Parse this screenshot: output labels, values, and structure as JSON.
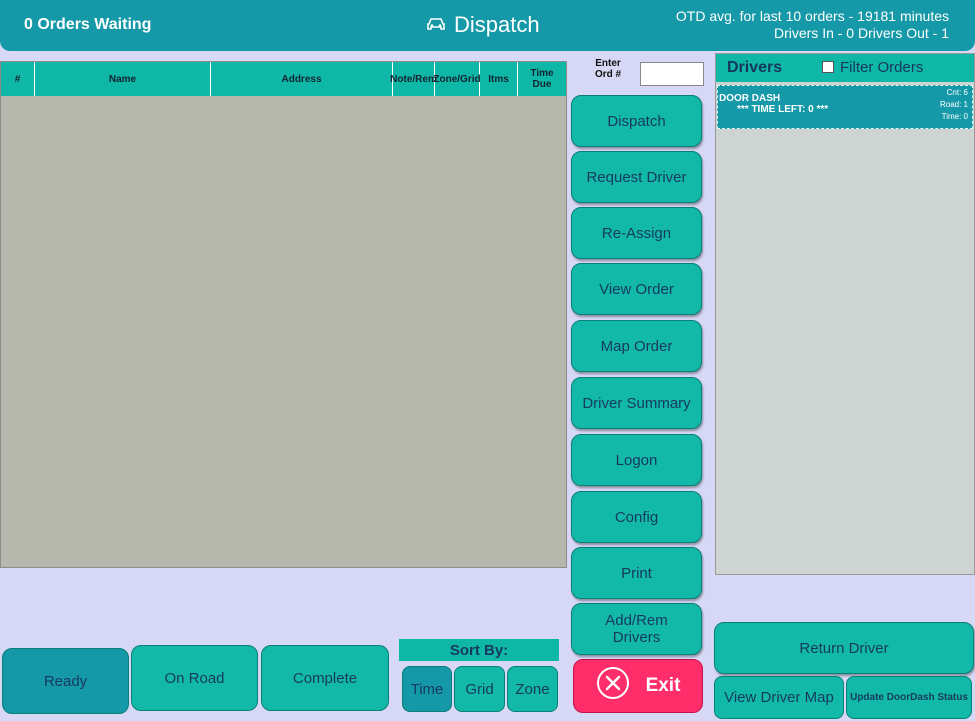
{
  "header": {
    "waiting": "0 Orders Waiting",
    "title": "Dispatch",
    "otd_line1": "OTD avg. for last 10 orders - 19181 minutes",
    "otd_line2": "Drivers In - 0   Drivers Out - 1",
    "title_icon": "car-icon"
  },
  "orders": {
    "columns": [
      "#",
      "Name",
      "Address",
      "Note/Rem",
      "Zone/Grid",
      "Itms",
      "Time Due"
    ],
    "rows": []
  },
  "order_entry": {
    "label": "Enter Ord #",
    "value": ""
  },
  "commands": [
    "Dispatch",
    "Request Driver",
    "Re-Assign",
    "View Order",
    "Map Order",
    "Driver Summary",
    "Logon",
    "Config",
    "Print",
    "Add/Rem Drivers"
  ],
  "exit_label": "Exit",
  "drivers": {
    "title": "Drivers",
    "filter_label": "Filter Orders",
    "filter_checked": false,
    "list": [
      {
        "name": "DOOR DASH",
        "time_left": "*** TIME LEFT: 0 ***",
        "cnt": "Cnt: 6",
        "road": "Road: 1",
        "time": "Time: 0"
      }
    ]
  },
  "status_tabs": [
    "Ready",
    "On Road",
    "Complete"
  ],
  "sort": {
    "label": "Sort By:",
    "options": [
      "Time",
      "Grid",
      "Zone"
    ],
    "selected": "Time"
  },
  "driver_actions": {
    "return": "Return Driver",
    "map": "View Driver Map",
    "update": "Update DoorDash Status"
  },
  "colors": {
    "teal": "#13b9a8",
    "dark_teal": "#1598a7",
    "background": "#d6d8f6",
    "exit": "#ff2d6a",
    "grid_bg": "#b6b7ad"
  }
}
